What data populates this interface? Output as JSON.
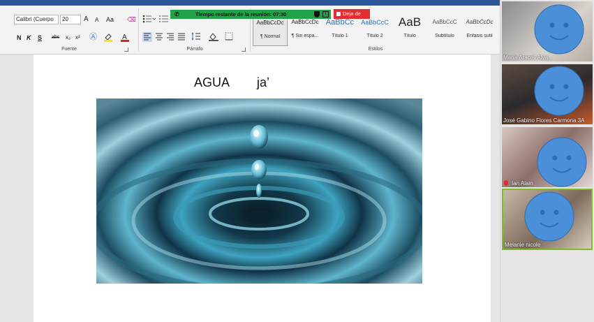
{
  "ribbon": {
    "font": {
      "family_value": "Calibri (Cuerpo",
      "size_value": "20",
      "grow_label": "A",
      "shrink_label": "A",
      "case_label": "Aa",
      "bold_label": "N",
      "italic_label": "K",
      "underline_label": "S",
      "strike_label": "abc",
      "subscript_label": "x₂",
      "superscript_label": "x²",
      "group_label": "Fuente"
    },
    "paragraph": {
      "group_label": "Párrafo"
    },
    "styles": {
      "group_label": "Estilos",
      "items": [
        {
          "preview": "AaBbCcDc",
          "name": "¶ Normal"
        },
        {
          "preview": "AaBbCcDc",
          "name": "¶ Sin espa..."
        },
        {
          "preview": "AaBbCc",
          "name": "Título 1"
        },
        {
          "preview": "AaBbCcC",
          "name": "Título 2"
        },
        {
          "preview": "AaB",
          "name": "Título"
        },
        {
          "preview": "AaBbCcC",
          "name": "Subtítulo"
        },
        {
          "preview": "AaBbCcDc",
          "name": "Énfasis sutil"
        }
      ]
    }
  },
  "meeting": {
    "timer_text": "Tiempo restante de la reunión: 07:30",
    "leave_label": "Deja de",
    "info_label": "i"
  },
  "document": {
    "title": "AGUA",
    "word": "ja’"
  },
  "participants": [
    {
      "name": "María Araceli Alva..."
    },
    {
      "name": "José Gabino Flores Carmona 3A"
    },
    {
      "name": "Ian Alain"
    },
    {
      "name": "Melanie nicole"
    }
  ],
  "colors": {
    "meeting_banner": "#1ea446",
    "leave_button": "#e12d2d",
    "smiley_fill": "#4a8fd8",
    "active_speaker_border": "#7dbb2a"
  },
  "icons": {
    "banner_phone": "✆",
    "recording_dot": "●"
  }
}
